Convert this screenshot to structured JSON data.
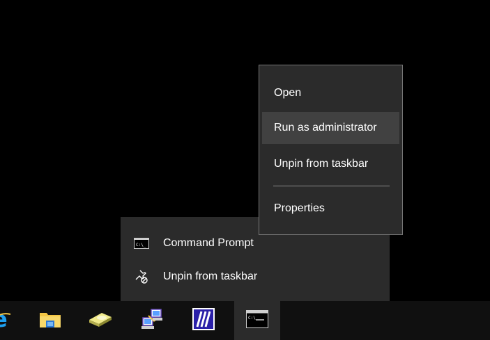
{
  "context_menu": {
    "items": [
      {
        "label": "Open"
      },
      {
        "label": "Run as administrator"
      },
      {
        "label": "Unpin from taskbar"
      },
      {
        "label": "Properties"
      }
    ]
  },
  "jump_list": {
    "items": [
      {
        "label": "Command Prompt",
        "icon": "command-prompt-icon"
      },
      {
        "label": "Unpin from taskbar",
        "icon": "unpin-icon"
      }
    ]
  },
  "taskbar": {
    "items": [
      {
        "icon": "internet-explorer-icon"
      },
      {
        "icon": "file-explorer-icon"
      },
      {
        "icon": "disk-drive-icon"
      },
      {
        "icon": "network-computers-icon"
      },
      {
        "icon": "powershell-ise-icon"
      },
      {
        "icon": "command-prompt-icon"
      }
    ]
  },
  "colors": {
    "desktop": "#000000",
    "menu_bg": "#2b2b2b",
    "menu_hover": "#414141",
    "taskbar_bg": "#101010",
    "ie_blue": "#1ea0f0",
    "folder_yellow": "#f4c644"
  }
}
